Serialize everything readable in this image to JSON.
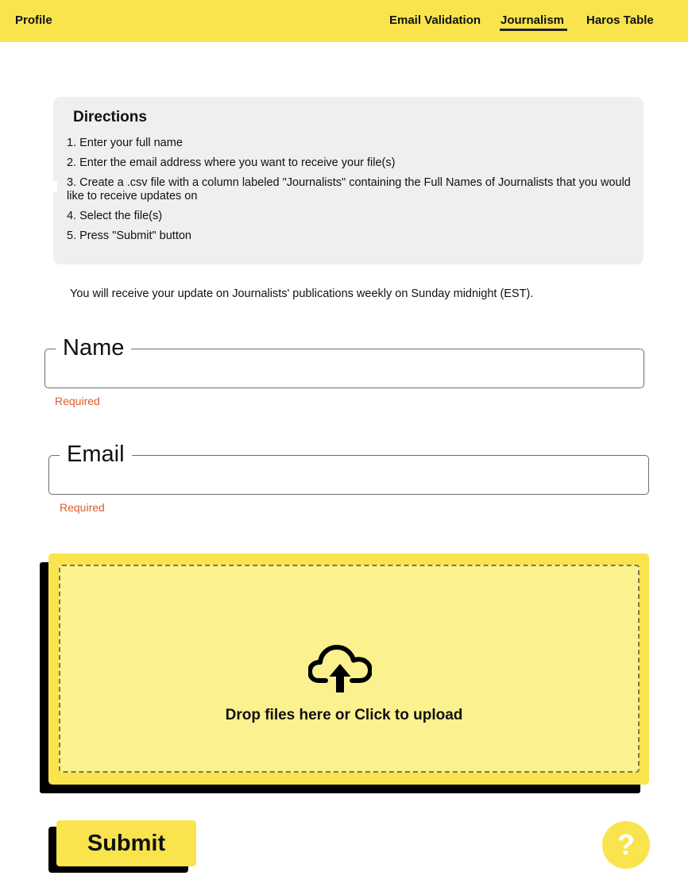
{
  "header": {
    "brand": "Profile",
    "nav": [
      "Email Validation",
      "Journalism",
      "Haros Table"
    ],
    "active_nav": "Journalism"
  },
  "directions": {
    "title": "Directions",
    "steps": [
      "1. Enter your full name",
      "2. Enter the email address where you want to receive your file(s)",
      "3. Create a .csv file with a column labeled \"Journalists\" containing the Full Names of Journalists that you would like to receive updates on",
      "4. Select the file(s)",
      "5. Press \"Submit\" button"
    ]
  },
  "notice": "You will receive your update on Journalists' publications weekly on Sunday midnight (EST).",
  "form": {
    "name": {
      "label": "Name",
      "value": "",
      "helper": "Required"
    },
    "email": {
      "label": "Email",
      "value": "",
      "helper": "Required"
    }
  },
  "upload": {
    "icon": "cloud-upload-icon",
    "label": "Drop files here or Click to upload"
  },
  "submit_label": "Submit",
  "help_label": "?",
  "colors": {
    "accent": "#f9e44e",
    "dropzone_fill": "#fbf18e",
    "panel": "#efefef",
    "error": "#dd5a2a"
  }
}
